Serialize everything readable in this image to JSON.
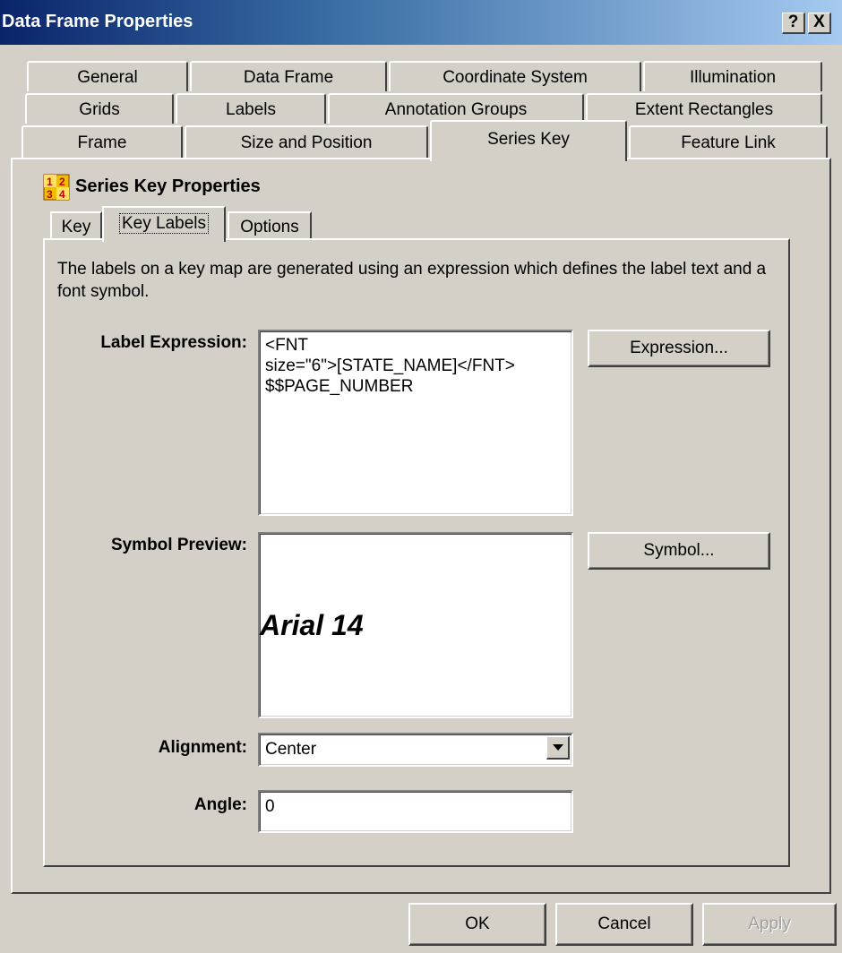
{
  "window": {
    "title": "Data Frame Properties",
    "help_label": "?",
    "close_label": "X"
  },
  "tabs": {
    "row1": [
      "General",
      "Data Frame",
      "Coordinate System",
      "Illumination"
    ],
    "row2": [
      "Grids",
      "Labels",
      "Annotation Groups",
      "Extent Rectangles"
    ],
    "row3": [
      "Frame",
      "Size and Position",
      "Series Key",
      "Feature Link"
    ],
    "active": "Series Key"
  },
  "section": {
    "title": "Series Key Properties",
    "icon": "series-key-icon"
  },
  "inner_tabs": {
    "items": [
      "Key",
      "Key Labels",
      "Options"
    ],
    "active": "Key Labels"
  },
  "description": "The labels on a key map are generated using an expression which defines the label text and a font symbol.",
  "fields": {
    "label_expression_label": "Label Expression:",
    "label_expression_value": "<FNT\nsize=\"6\">[STATE_NAME]</FNT>\n$$PAGE_NUMBER",
    "expression_button": "Expression...",
    "symbol_preview_label": "Symbol Preview:",
    "symbol_preview_text": "Arial 14",
    "symbol_button": "Symbol...",
    "alignment_label": "Alignment:",
    "alignment_value": "Center",
    "angle_label": "Angle:",
    "angle_value": "0"
  },
  "buttons": {
    "ok": "OK",
    "cancel": "Cancel",
    "apply": "Apply",
    "apply_enabled": false
  },
  "colors": {
    "dialog_bg": "#d4d0c8",
    "title_gradient_start": "#0a246a",
    "title_gradient_end": "#a6caf0",
    "field_bg": "#ffffff"
  }
}
